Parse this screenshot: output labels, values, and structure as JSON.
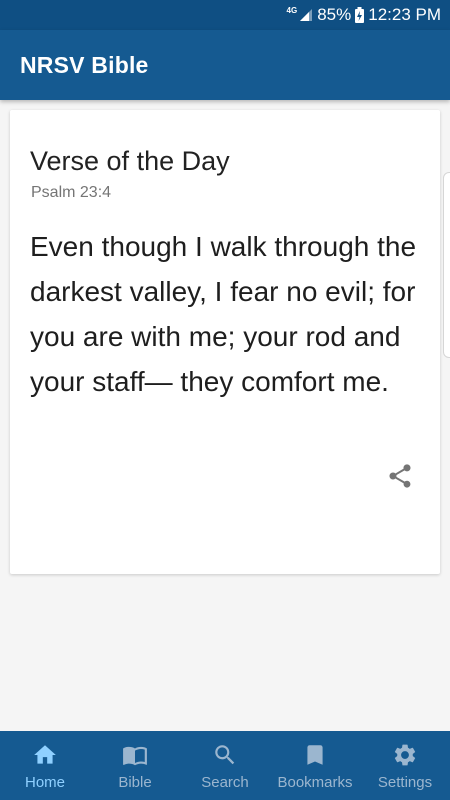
{
  "status_bar": {
    "network": "4G",
    "battery": "85%",
    "time": "12:23 PM"
  },
  "app_bar": {
    "title": "NRSV Bible"
  },
  "verse_card": {
    "title": "Verse of the Day",
    "reference": "Psalm 23:4",
    "text": "Even though I walk through the darkest valley, I fear no evil; for you are with me; your rod and your staff— they comfort me."
  },
  "bottom_nav": {
    "active": "home",
    "items": [
      {
        "id": "home",
        "label": "Home",
        "icon": "home-icon"
      },
      {
        "id": "bible",
        "label": "Bible",
        "icon": "book-icon"
      },
      {
        "id": "search",
        "label": "Search",
        "icon": "search-icon"
      },
      {
        "id": "bookmarks",
        "label": "Bookmarks",
        "icon": "bookmark-icon"
      },
      {
        "id": "settings",
        "label": "Settings",
        "icon": "gear-icon"
      }
    ]
  },
  "colors": {
    "status_bar": "#0f4f83",
    "app_bar": "#155a91",
    "nav_inactive": "#9bb6cf",
    "nav_active": "#8fd0ff"
  }
}
